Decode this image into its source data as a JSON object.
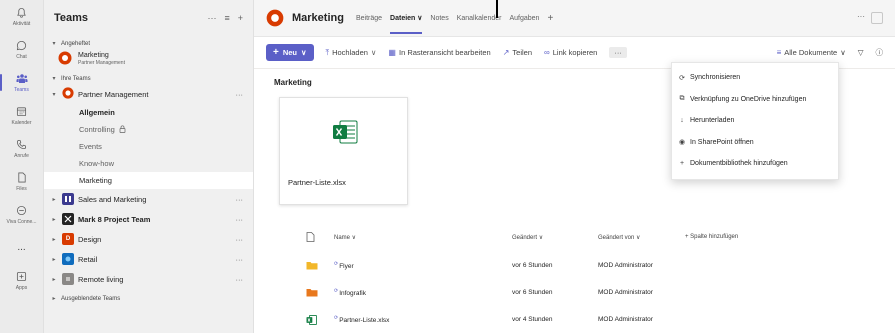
{
  "rail": {
    "items": [
      {
        "label": "Aktivität",
        "icon": "bell-icon"
      },
      {
        "label": "Chat",
        "icon": "chat-icon"
      },
      {
        "label": "Teams",
        "icon": "teams-icon",
        "active": true
      },
      {
        "label": "Kalender",
        "icon": "calendar-icon"
      },
      {
        "label": "Anrufe",
        "icon": "phone-icon"
      },
      {
        "label": "Files",
        "icon": "file-icon"
      },
      {
        "label": "Viva Conne...",
        "icon": "viva-icon"
      },
      {
        "label": "...",
        "icon": "more-icon"
      },
      {
        "label": "Apps",
        "icon": "apps-icon"
      }
    ]
  },
  "pane": {
    "title": "Teams",
    "tools": [
      "···",
      "≡",
      "+"
    ],
    "pinned_label": "Angeheftet",
    "pinned": {
      "name": "Marketing",
      "sub": "Partner Management"
    },
    "your_teams_label": "Ihre Teams",
    "teams": [
      {
        "name": "Partner Management",
        "expanded": true,
        "color": "#d83b01",
        "channels": [
          {
            "name": "Allgemein",
            "bold": true
          },
          {
            "name": "Controlling",
            "icon": "lock-icon"
          },
          {
            "name": "Events"
          },
          {
            "name": "Know-how"
          },
          {
            "name": "Marketing",
            "selected": true
          }
        ]
      },
      {
        "name": "Sales and Marketing",
        "color": "#3b3a8f",
        "initial": ""
      },
      {
        "name": "Mark 8 Project Team",
        "color": "#242424",
        "bold": true,
        "initial": ""
      },
      {
        "name": "Design",
        "color": "#d83b01",
        "initial": "D"
      },
      {
        "name": "Retail",
        "color": "#0f6cbd",
        "initial": ""
      },
      {
        "name": "Remote living",
        "color": "#8a8886",
        "initial": ""
      }
    ],
    "hidden_label": "Ausgeblendete Teams"
  },
  "main": {
    "title": "Marketing",
    "tabs": [
      {
        "label": "Beiträge"
      },
      {
        "label": "Dateien ∨",
        "active": true
      },
      {
        "label": "Notes"
      },
      {
        "label": "Kanalkalender"
      },
      {
        "label": "Aufgaben"
      },
      {
        "label": "+"
      }
    ],
    "header_more": "···",
    "toolbar": {
      "new_label": "Neu",
      "upload": "Hochladen",
      "grid_edit": "In Rasteransicht bearbeiten",
      "share": "Teilen",
      "copy_link": "Link kopieren",
      "more": "···",
      "all_docs": "Alle Dokumente",
      "filter": "▽"
    },
    "breadcrumb": "Marketing",
    "tile": {
      "name": "Partner-Liste.xlsx"
    },
    "list": {
      "headers": {
        "name": "Name",
        "modified": "Geändert",
        "modified_by": "Geändert von",
        "add_column": "+ Spalte hinzufügen"
      },
      "rows": [
        {
          "name": "Flyer",
          "type": "folder",
          "modified": "vor 6 Stunden",
          "by": "MOD Administrator"
        },
        {
          "name": "Infografik",
          "type": "folder",
          "modified": "vor 6 Stunden",
          "by": "MOD Administrator"
        },
        {
          "name": "Partner-Liste.xlsx",
          "type": "excel",
          "modified": "vor 4 Stunden",
          "by": "MOD Administrator"
        }
      ]
    }
  },
  "menu": {
    "items": [
      {
        "label": "Synchronisieren",
        "icon": "sync-icon",
        "glyph": "⟳"
      },
      {
        "label": "Verknüpfung zu OneDrive hinzufügen",
        "icon": "shortcut-icon",
        "glyph": "⧉"
      },
      {
        "label": "Herunterladen",
        "icon": "download-icon",
        "glyph": "↓"
      },
      {
        "label": "In SharePoint öffnen",
        "icon": "sharepoint-icon",
        "glyph": "◉"
      },
      {
        "label": "Dokumentbibliothek hinzufügen",
        "icon": "add-icon",
        "glyph": "+"
      }
    ]
  },
  "colors": {
    "accent": "#5b5fc7",
    "excel": "#107c41",
    "folder": "#f2b72a"
  }
}
